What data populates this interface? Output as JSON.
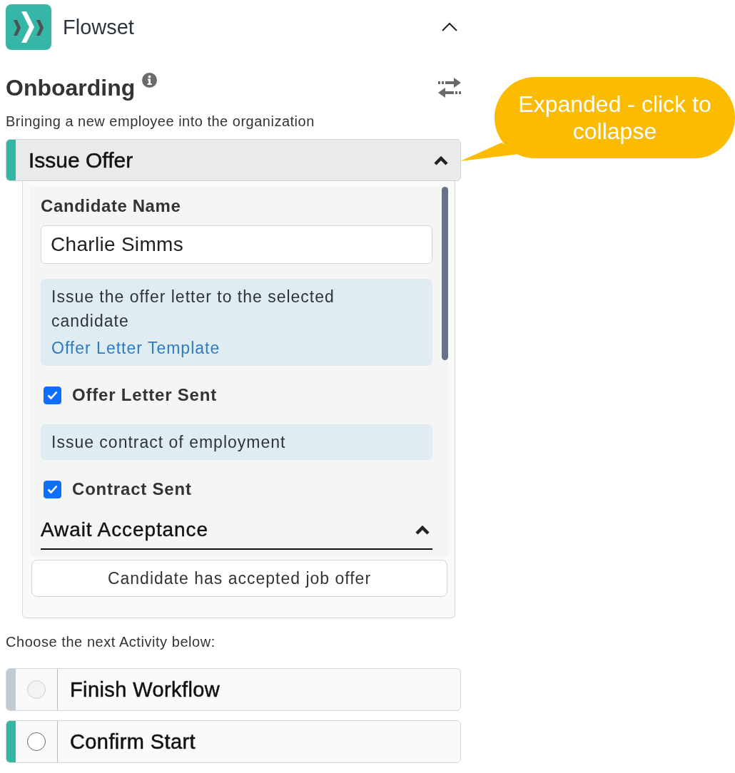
{
  "header": {
    "app_name": "Flowset",
    "expanded": true
  },
  "workflow": {
    "title": "Onboarding",
    "description": "Bringing a new employee into the organization"
  },
  "current_activity": {
    "title": "Issue Offer",
    "expanded": true,
    "fields": [
      {
        "kind": "text_field",
        "label": "Candidate Name",
        "value": "Charlie Simms"
      },
      {
        "kind": "note",
        "text": "Issue the offer letter to the selected candidate",
        "link": "Offer Letter Template"
      },
      {
        "kind": "checkbox",
        "label": "Offer Letter Sent",
        "checked": true
      },
      {
        "kind": "note",
        "text": "Issue contract of employment"
      },
      {
        "kind": "checkbox",
        "label": "Contract Sent",
        "checked": true
      },
      {
        "kind": "section",
        "title": "Await Acceptance",
        "expanded": true
      }
    ],
    "complete_button": "Candidate has accepted job offer"
  },
  "next_prompt": "Choose the next Activity below:",
  "next_activities": [
    {
      "title": "Finish Workflow",
      "color": "#c2cad1",
      "disabled": true,
      "selected": false
    },
    {
      "title": "Confirm Start",
      "color": "#34b5a5",
      "disabled": false,
      "selected": false
    }
  ],
  "callout": {
    "text": "Expanded - click to collapse"
  }
}
